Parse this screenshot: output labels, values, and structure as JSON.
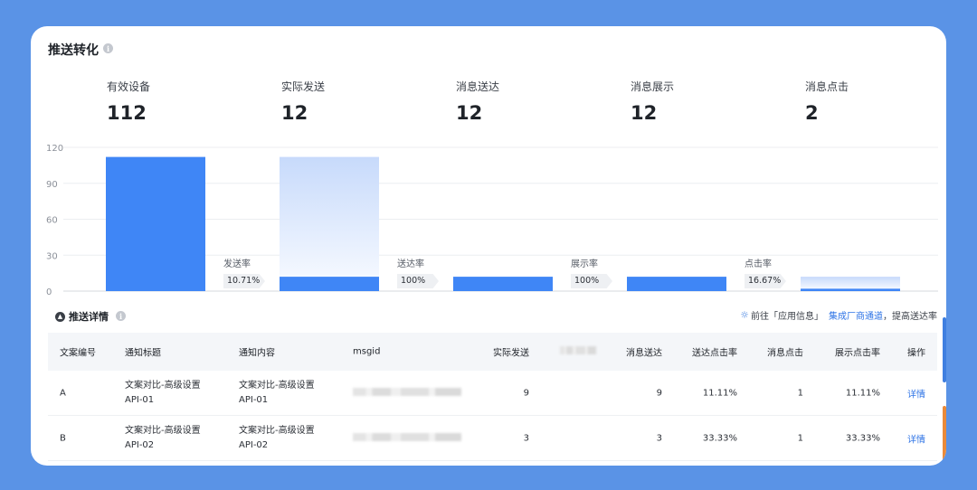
{
  "panel": {
    "title": "推送转化",
    "info_icon": "i"
  },
  "metrics": [
    {
      "label": "有效设备",
      "value": "112"
    },
    {
      "label": "实际发送",
      "value": "12"
    },
    {
      "label": "消息送达",
      "value": "12"
    },
    {
      "label": "消息展示",
      "value": "12"
    },
    {
      "label": "消息点击",
      "value": "2"
    }
  ],
  "chart_data": {
    "type": "bar",
    "categories": [
      "有效设备",
      "实际发送",
      "消息送达",
      "消息展示",
      "消息点击"
    ],
    "values": [
      112,
      12,
      12,
      12,
      2
    ],
    "ylim": [
      0,
      120
    ],
    "yticks": [
      "0",
      "30",
      "60",
      "90",
      "120"
    ],
    "grid": true,
    "bar_color": "#3f86f6",
    "rates": [
      {
        "label": "发送率",
        "value": "10.71%"
      },
      {
        "label": "送达率",
        "value": "100%"
      },
      {
        "label": "展示率",
        "value": "100%"
      },
      {
        "label": "点击率",
        "value": "16.67%"
      }
    ]
  },
  "details": {
    "title": "推送详情",
    "notice_prefix": "前往「应用信息」",
    "notice_link": "集成厂商通道",
    "notice_suffix": "，提高送达率",
    "link_color": "#2f74e6",
    "columns": [
      "文案编号",
      "通知标题",
      "通知内容",
      "msgid",
      "实际发送",
      "",
      "消息送达",
      "送达点击率",
      "消息点击",
      "展示点击率",
      "操作"
    ],
    "rows": [
      {
        "id": "A",
        "title1": "文案对比-高级设置",
        "title2": "API-01",
        "content1": "文案对比-高级设置",
        "content2": "API-01",
        "sent": "9",
        "delivered": "9",
        "deliver_ctr": "11.11%",
        "clicks": "1",
        "show_ctr": "11.11%",
        "action": "详情"
      },
      {
        "id": "B",
        "title1": "文案对比-高级设置",
        "title2": "API-02",
        "content1": "文案对比-高级设置",
        "content2": "API-02",
        "sent": "3",
        "delivered": "3",
        "deliver_ctr": "33.33%",
        "clicks": "1",
        "show_ctr": "33.33%",
        "action": "详情"
      }
    ]
  }
}
